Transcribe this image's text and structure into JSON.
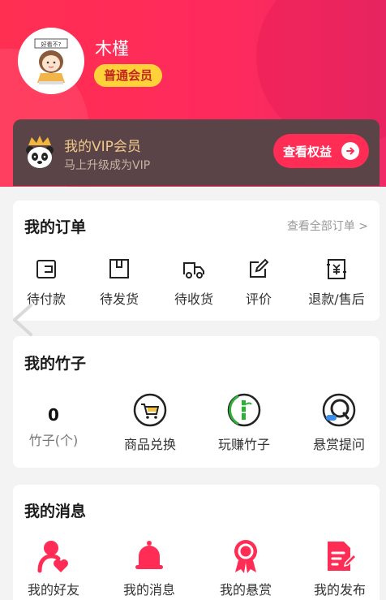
{
  "profile": {
    "name": "木槿",
    "member_level": "普通会员",
    "avatar_caption": "好看不?"
  },
  "vip": {
    "title": "我的VIP会员",
    "subtitle": "马上升级成为VIP",
    "button": "查看权益"
  },
  "orders": {
    "title": "我的订单",
    "see_all": "查看全部订单 >",
    "items": [
      {
        "label": "待付款",
        "icon": "wallet-icon"
      },
      {
        "label": "待发货",
        "icon": "package-icon"
      },
      {
        "label": "待收货",
        "icon": "truck-icon"
      },
      {
        "label": "评价",
        "icon": "edit-icon"
      },
      {
        "label": "退款/售后",
        "icon": "refund-icon"
      }
    ]
  },
  "bamboo": {
    "title": "我的竹子",
    "count": "0",
    "count_label": "竹子(个)",
    "items": [
      {
        "label": "商品兑换",
        "icon": "cart-icon"
      },
      {
        "label": "玩赚竹子",
        "icon": "bamboo-icon"
      },
      {
        "label": "悬赏提问",
        "icon": "question-icon"
      }
    ]
  },
  "messages": {
    "title": "我的消息",
    "items": [
      {
        "label": "我的好友",
        "icon": "friend-icon"
      },
      {
        "label": "我的消息",
        "icon": "bell-icon"
      },
      {
        "label": "我的悬赏",
        "icon": "award-icon"
      },
      {
        "label": "我的发布",
        "icon": "publish-icon"
      }
    ]
  },
  "colors": {
    "brand": "#ff2d55",
    "vip_bg": "#5a4447",
    "gold": "#f0c98a",
    "badge": "#ffd23a"
  }
}
